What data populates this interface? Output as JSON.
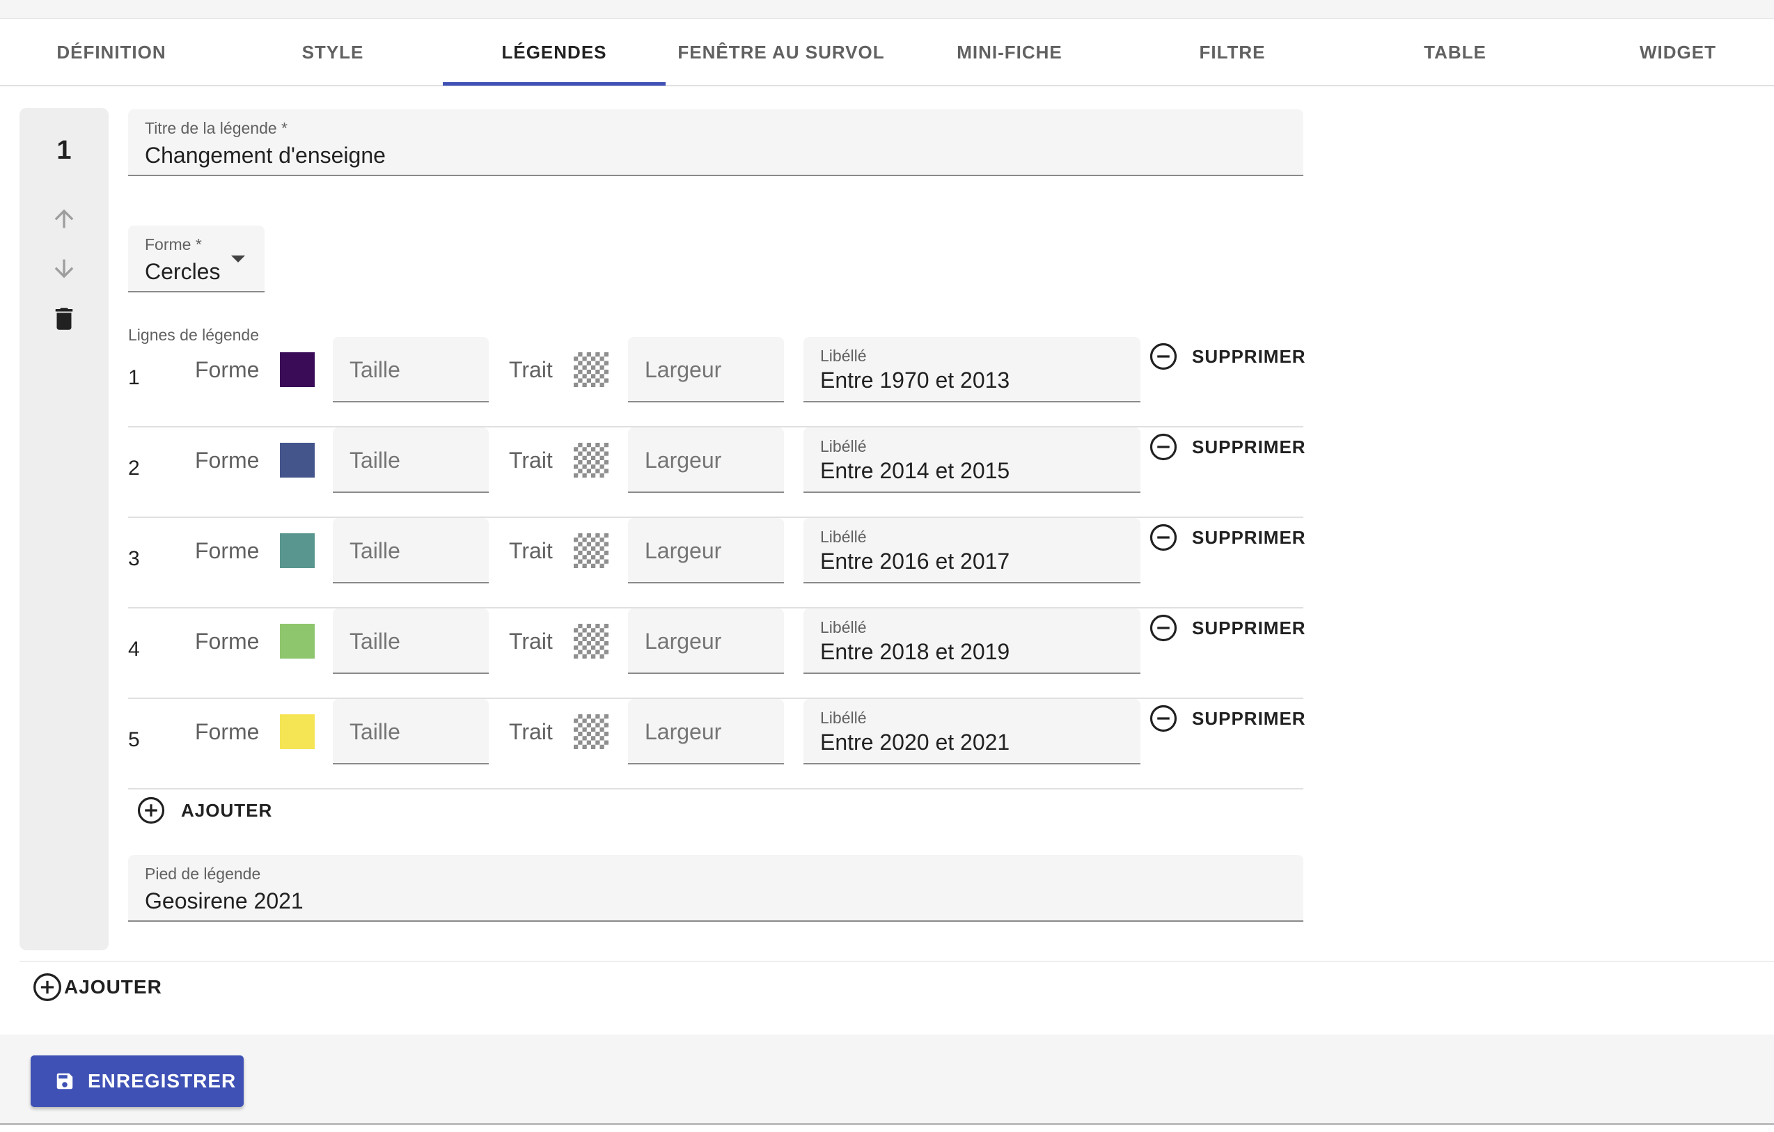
{
  "tabs": [
    {
      "label": "DÉFINITION",
      "active": false
    },
    {
      "label": "STYLE",
      "active": false
    },
    {
      "label": "LÉGENDES",
      "active": true
    },
    {
      "label": "FENÊTRE AU SURVOL",
      "active": false
    },
    {
      "label": "MINI-FICHE",
      "active": false
    },
    {
      "label": "FILTRE",
      "active": false
    },
    {
      "label": "TABLE",
      "active": false
    },
    {
      "label": "WIDGET",
      "active": false
    }
  ],
  "legend": {
    "index": "1",
    "title_field": {
      "label": "Titre de la légende *",
      "value": "Changement d'enseigne"
    },
    "shape_field": {
      "label": "Forme *",
      "value": "Cercles"
    },
    "lines_label": "Lignes de légende",
    "lines": [
      {
        "num": "1",
        "forme_label": "Forme",
        "color": "#3a0b57",
        "taille_placeholder": "Taille",
        "trait_label": "Trait",
        "largeur_placeholder": "Largeur",
        "libelle_label": "Libéllé",
        "libelle_value": "Entre 1970 et 2013",
        "delete_label": "SUPPRIMER"
      },
      {
        "num": "2",
        "forme_label": "Forme",
        "color": "#44558b",
        "taille_placeholder": "Taille",
        "trait_label": "Trait",
        "largeur_placeholder": "Largeur",
        "libelle_label": "Libéllé",
        "libelle_value": "Entre 2014 et 2015",
        "delete_label": "SUPPRIMER"
      },
      {
        "num": "3",
        "forme_label": "Forme",
        "color": "#5a9690",
        "taille_placeholder": "Taille",
        "trait_label": "Trait",
        "largeur_placeholder": "Largeur",
        "libelle_label": "Libéllé",
        "libelle_value": "Entre 2016 et 2017",
        "delete_label": "SUPPRIMER"
      },
      {
        "num": "4",
        "forme_label": "Forme",
        "color": "#8ec66d",
        "taille_placeholder": "Taille",
        "trait_label": "Trait",
        "largeur_placeholder": "Largeur",
        "libelle_label": "Libéllé",
        "libelle_value": "Entre 2018 et 2019",
        "delete_label": "SUPPRIMER"
      },
      {
        "num": "5",
        "forme_label": "Forme",
        "color": "#f5e554",
        "taille_placeholder": "Taille",
        "trait_label": "Trait",
        "largeur_placeholder": "Largeur",
        "libelle_label": "Libéllé",
        "libelle_value": "Entre 2020 et 2021",
        "delete_label": "SUPPRIMER"
      }
    ],
    "add_line_label": "AJOUTER",
    "footer_field": {
      "label": "Pied de légende",
      "value": "Geosirene 2021"
    }
  },
  "add_legend_label": "AJOUTER",
  "save_label": "ENREGISTRER",
  "colors": {
    "accent": "#3f51b5"
  },
  "icons": {
    "move_up": "arrow-up-icon",
    "move_down": "arrow-down-icon",
    "delete_legend": "trash-icon",
    "remove_line": "minus-circle-icon",
    "add": "plus-circle-icon",
    "save": "floppy-disk-icon",
    "dropdown": "caret-down-icon"
  }
}
